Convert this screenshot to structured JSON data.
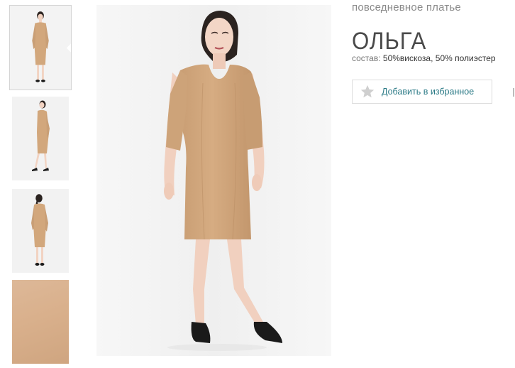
{
  "gallery": {
    "thumbnails": [
      {
        "name": "thumb-front",
        "active": true
      },
      {
        "name": "thumb-side",
        "active": false
      },
      {
        "name": "thumb-back",
        "active": false
      },
      {
        "name": "thumb-fabric",
        "active": false
      }
    ],
    "colors": {
      "dress": "#d2a77c",
      "skin": "#f2d3c2",
      "hair": "#2b2320",
      "shoes": "#1a1a1a",
      "background": "#f4f4f4"
    }
  },
  "product": {
    "category": "повседневное платье",
    "name": "ОЛЬГА",
    "composition_label": "состав:",
    "composition_value": "50%вискоза, 50% полиэстер",
    "favorite_label": "Добавить в избранное"
  },
  "accent_color": "#2b7a86"
}
